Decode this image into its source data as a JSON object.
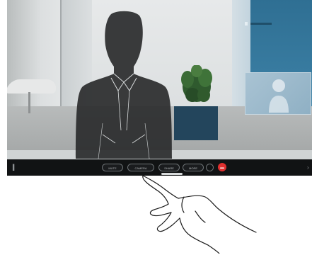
{
  "call": {
    "controls": [
      {
        "id": "mute",
        "label": "MUTE"
      },
      {
        "id": "camera",
        "label": "CAMERA"
      },
      {
        "id": "share",
        "label": "SHARE"
      },
      {
        "id": "more",
        "label": "MORE"
      }
    ],
    "end_call_color": "#e0302f",
    "bar_color": "#111314"
  },
  "icons": {
    "left": "mic-icon",
    "end": "end-call-icon",
    "right": "chevron-icon"
  }
}
